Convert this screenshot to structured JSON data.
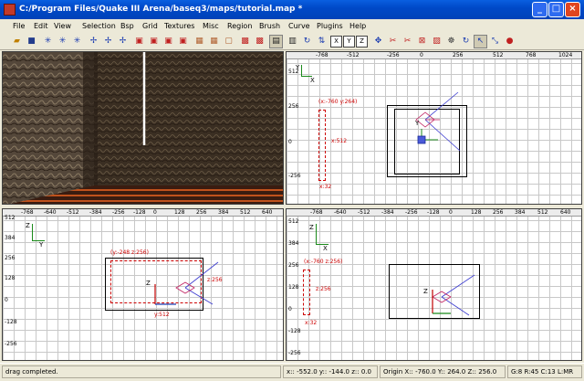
{
  "window": {
    "title": "C:/Program Files/Quake III Arena/baseq3/maps/tutorial.map *"
  },
  "menu": [
    "File",
    "Edit",
    "View",
    "Selection",
    "Bsp",
    "Grid",
    "Textures",
    "Misc",
    "Region",
    "Brush",
    "Curve",
    "Plugins",
    "Help"
  ],
  "toolbar": {
    "buttons": [
      "open-icon",
      "save-icon",
      "flip-x-icon",
      "flip-y-icon",
      "flip-z-icon",
      "rotate-x-icon",
      "rotate-y-icon",
      "rotate-z-icon",
      "select-complete-tall-icon",
      "select-touching-icon",
      "select-partial-tall-icon",
      "select-inside-icon",
      "csg-subtract-icon",
      "csg-merge-icon",
      "hollow-icon",
      "clipper-icon",
      "change-view-icon",
      "texture-view-icon",
      "view-x-icon",
      "view-y-icon",
      "view-z-icon",
      "cubic-clip-icon",
      "camera-movement-icon",
      "entities-icon",
      "patch-icon",
      "drop-patch-icon",
      "bend-icon",
      "scale-icon"
    ],
    "view_x": "X",
    "view_y": "Y",
    "view_z": "Z"
  },
  "top_view": {
    "ruler": [
      "-768",
      "-512",
      "-256",
      "0",
      "256",
      "512",
      "768",
      "1024"
    ],
    "ylabels": [
      "512",
      "256",
      "0",
      "-256"
    ],
    "sel_coord": "(x:-760  y:264)",
    "sel_height": "x:512",
    "sel_width": "x:32",
    "axis_x": "X",
    "axis_y": "Y",
    "brush_y": "Y"
  },
  "side_view": {
    "ruler": [
      "-768",
      "-640",
      "-512",
      "-384",
      "-256",
      "-128",
      "0",
      "128",
      "256",
      "384",
      "512",
      "640"
    ],
    "ylabels": [
      "512",
      "384",
      "256",
      "128",
      "0",
      "-128",
      "-256"
    ],
    "sel_coord": "(y:-248  z:256)",
    "sel_height": "z:256",
    "sel_width": "y:512",
    "axis_y": "Y",
    "axis_z": "Z",
    "brush_z": "Z"
  },
  "front_view": {
    "ruler": [
      "-768",
      "-640",
      "-512",
      "-384",
      "-256",
      "-128",
      "0",
      "128",
      "256",
      "384",
      "512",
      "640"
    ],
    "ylabels": [
      "512",
      "384",
      "256",
      "128",
      "0",
      "-128",
      "-256"
    ],
    "sel_coord": "(x:-760  z:256)",
    "sel_height": "z:256",
    "sel_width": "x:32",
    "axis_x": "X",
    "axis_z": "Z",
    "brush_z": "Z"
  },
  "status": {
    "message": "drag completed.",
    "xyz": "x:: -552.0  y:: -144.0  z:: 0.0",
    "origin": "Origin X:: -760.0  Y:: 264.0  Z:: 256.0",
    "grid": "G:8 R:45 C:13 L:MR"
  }
}
